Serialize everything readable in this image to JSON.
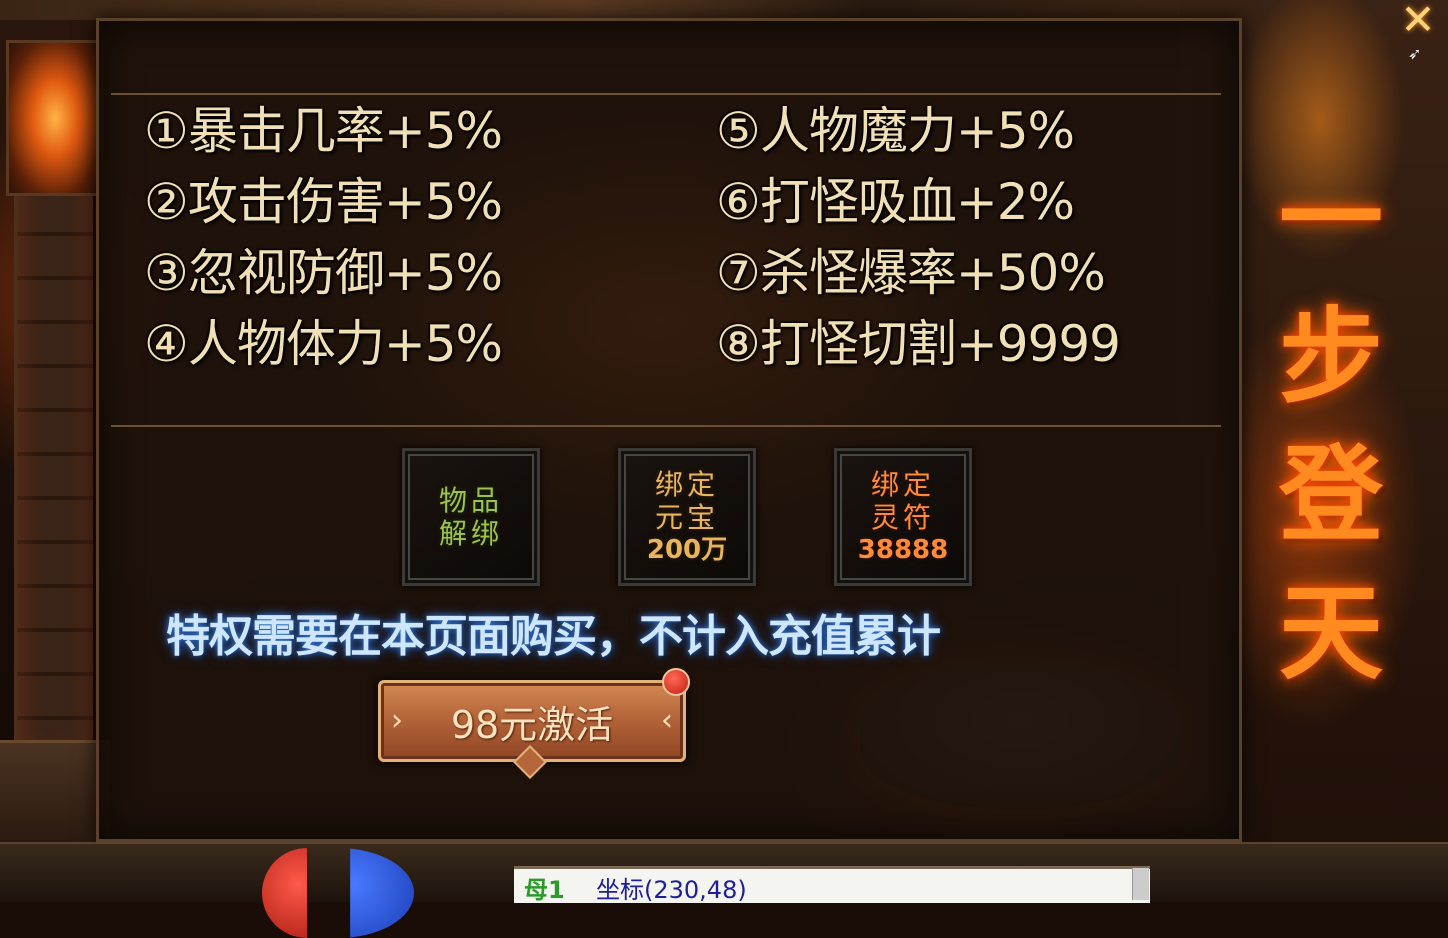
{
  "panel": {
    "stats_left": [
      "①暴击几率+5%",
      "②攻击伤害+5%",
      "③忽视防御+5%",
      "④人物体力+5%"
    ],
    "stats_right": [
      "⑤人物魔力+5%",
      "⑥打怪吸血+2%",
      "⑦杀怪爆率+50%",
      "⑧打怪切割+9999"
    ],
    "rewards": [
      {
        "line1": "物品",
        "line2": "解绑",
        "color": "#9ec24a"
      },
      {
        "line1": "绑定",
        "line2": "元宝",
        "amount": "200万",
        "color": "#e8b55c"
      },
      {
        "line1": "绑定",
        "line2": "灵符",
        "amount": "38888",
        "color": "#ff8a3a"
      }
    ],
    "notice": "特权需要在本页面购买，不计入充值累计",
    "activate_label": "98元激活"
  },
  "banner": {
    "chars": [
      "一",
      "步",
      "登",
      "天"
    ]
  },
  "hud": {
    "chat_tag": "母1",
    "chat_text": "坐标(230,48)"
  },
  "icons": {
    "close": "close-icon",
    "arrow_left": "chevron-right-icon",
    "arrow_right": "chevron-left-icon"
  }
}
